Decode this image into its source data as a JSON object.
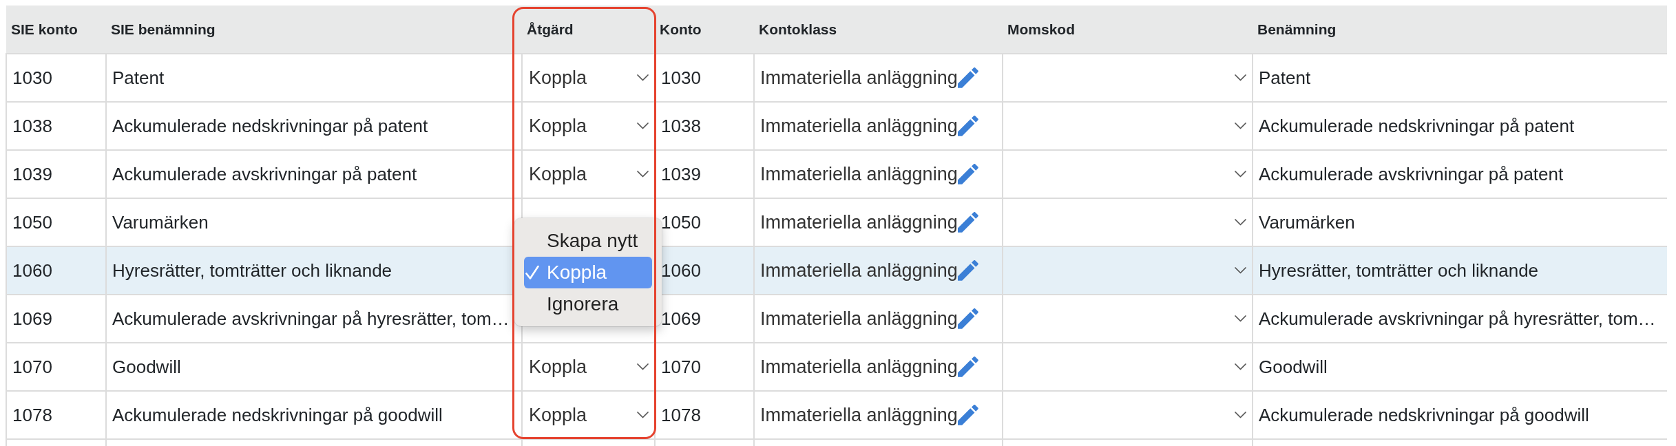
{
  "table": {
    "columns": [
      {
        "label": "SIE konto",
        "kind": "text",
        "highlighted": false
      },
      {
        "label": "SIE benämning",
        "kind": "text",
        "highlighted": false
      },
      {
        "label": "Åtgärd",
        "kind": "select",
        "highlighted": true,
        "options": [
          {
            "label": "Skapa nytt",
            "selected": false
          },
          {
            "label": "Koppla",
            "selected": true
          },
          {
            "label": "Ignorera",
            "selected": false
          }
        ]
      },
      {
        "label": "Konto",
        "kind": "text",
        "highlighted": false
      },
      {
        "label": "Kontoklass",
        "kind": "editable",
        "highlighted": false
      },
      {
        "label": "Momskod",
        "kind": "select",
        "highlighted": false
      },
      {
        "label": "Benämning",
        "kind": "text",
        "highlighted": false
      }
    ],
    "rows": [
      {
        "selected": false,
        "menu_open": false,
        "cells": [
          "1030",
          "Patent",
          "Koppla",
          "1030",
          "Immateriella anläggning",
          null,
          "Patent"
        ]
      },
      {
        "selected": false,
        "menu_open": false,
        "cells": [
          "1038",
          "Ackumulerade nedskrivningar på patent",
          "Koppla",
          "1038",
          "Immateriella anläggning",
          null,
          "Ackumulerade nedskrivningar på patent"
        ]
      },
      {
        "selected": false,
        "menu_open": false,
        "cells": [
          "1039",
          "Ackumulerade avskrivningar på patent",
          "Koppla",
          "1039",
          "Immateriella anläggning",
          null,
          "Ackumulerade avskrivningar på patent"
        ]
      },
      {
        "selected": false,
        "menu_open": false,
        "cells": [
          "1050",
          "Varumärken",
          null,
          "1050",
          "Immateriella anläggning",
          null,
          "Varumärken"
        ]
      },
      {
        "selected": true,
        "menu_open": true,
        "cells": [
          "1060",
          "Hyresrätter, tomträtter och liknande",
          null,
          "1060",
          "Immateriella anläggning",
          null,
          "Hyresrätter, tomträtter och liknande"
        ]
      },
      {
        "selected": false,
        "menu_open": false,
        "cells": [
          "1069",
          "Ackumulerade avskrivningar på hyresrätter, tom…",
          null,
          "1069",
          "Immateriella anläggning",
          null,
          "Ackumulerade avskrivningar på hyresrätter, tom…"
        ]
      },
      {
        "selected": false,
        "menu_open": false,
        "cells": [
          "1070",
          "Goodwill",
          "Koppla",
          "1070",
          "Immateriella anläggning",
          null,
          "Goodwill"
        ]
      },
      {
        "selected": false,
        "menu_open": false,
        "cells": [
          "1078",
          "Ackumulerade nedskrivningar på goodwill",
          "Koppla",
          "1078",
          "Immateriella anläggning",
          null,
          "Ackumulerade nedskrivningar på goodwill"
        ]
      }
    ]
  }
}
